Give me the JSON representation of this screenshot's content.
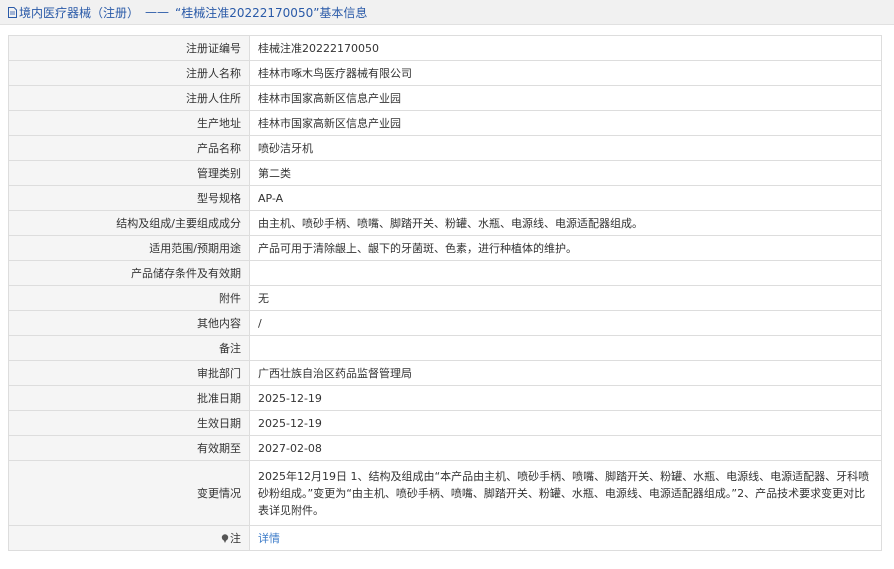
{
  "header": {
    "category": "境内医疗器械（注册）",
    "separator": "——",
    "title": "“桂械注准20222170050”基本信息"
  },
  "rows": [
    {
      "label": "注册证编号",
      "value": "桂械注准20222170050"
    },
    {
      "label": "注册人名称",
      "value": "桂林市啄木鸟医疗器械有限公司"
    },
    {
      "label": "注册人住所",
      "value": "桂林市国家高新区信息产业园"
    },
    {
      "label": "生产地址",
      "value": "桂林市国家高新区信息产业园"
    },
    {
      "label": "产品名称",
      "value": "喷砂洁牙机"
    },
    {
      "label": "管理类别",
      "value": "第二类"
    },
    {
      "label": "型号规格",
      "value": "AP-A"
    },
    {
      "label": "结构及组成/主要组成成分",
      "value": "由主机、喷砂手柄、喷嘴、脚踏开关、粉罐、水瓶、电源线、电源适配器组成。"
    },
    {
      "label": "适用范围/预期用途",
      "value": "产品可用于清除龈上、龈下的牙菌斑、色素，进行种植体的维护。"
    },
    {
      "label": "产品储存条件及有效期",
      "value": ""
    },
    {
      "label": "附件",
      "value": "无"
    },
    {
      "label": "其他内容",
      "value": "/"
    },
    {
      "label": "备注",
      "value": ""
    },
    {
      "label": "审批部门",
      "value": "广西壮族自治区药品监督管理局"
    },
    {
      "label": "批准日期",
      "value": "2025-12-19"
    },
    {
      "label": "生效日期",
      "value": "2025-12-19"
    },
    {
      "label": "有效期至",
      "value": "2027-02-08"
    },
    {
      "label": "变更情况",
      "value": "2025年12月19日 1、结构及组成由“本产品由主机、喷砂手柄、喷嘴、脚踏开关、粉罐、水瓶、电源线、电源适配器、牙科喷砂粉组成。”变更为“由主机、喷砂手柄、喷嘴、脚踏开关、粉罐、水瓶、电源线、电源适配器组成。”2、产品技术要求变更对比表详见附件。"
    }
  ],
  "note": {
    "icon": "pin-icon",
    "label": "注",
    "link_text": "详情"
  },
  "colors": {
    "header_text": "#2a5aa8",
    "link": "#3a7ac8",
    "label_bg": "#f5f5f5",
    "border": "#dddddd"
  }
}
